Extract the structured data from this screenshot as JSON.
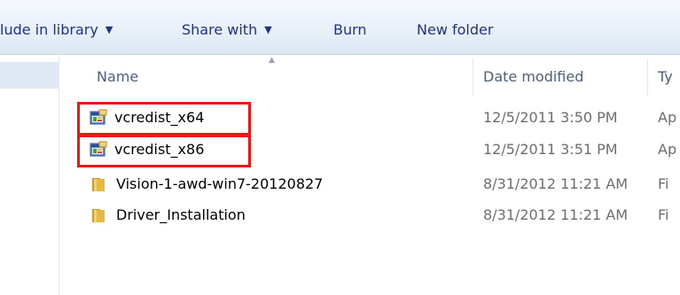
{
  "toolbar": {
    "include_label": "lude in library",
    "share_label": "Share with",
    "burn_label": "Burn",
    "new_folder_label": "New folder"
  },
  "columns": {
    "name": "Name",
    "date_modified": "Date modified",
    "type": "Ty"
  },
  "files": [
    {
      "name": "vcredist_x64",
      "date": "12/5/2011 3:50 PM",
      "type": "Ap",
      "icon": "installer-icon"
    },
    {
      "name": "vcredist_x86",
      "date": "12/5/2011 3:51 PM",
      "type": "Ap",
      "icon": "installer-icon"
    },
    {
      "name": "Vision-1-awd-win7-20120827",
      "date": "8/31/2012 11:21 AM",
      "type": "Fi",
      "icon": "folder-icon"
    },
    {
      "name": "Driver_Installation",
      "date": "8/31/2012 11:21 AM",
      "type": "Fi",
      "icon": "folder-icon"
    }
  ],
  "colors": {
    "toolbar_text": "#1e3287",
    "highlight": "#f21414",
    "folder": "#e8b845"
  }
}
